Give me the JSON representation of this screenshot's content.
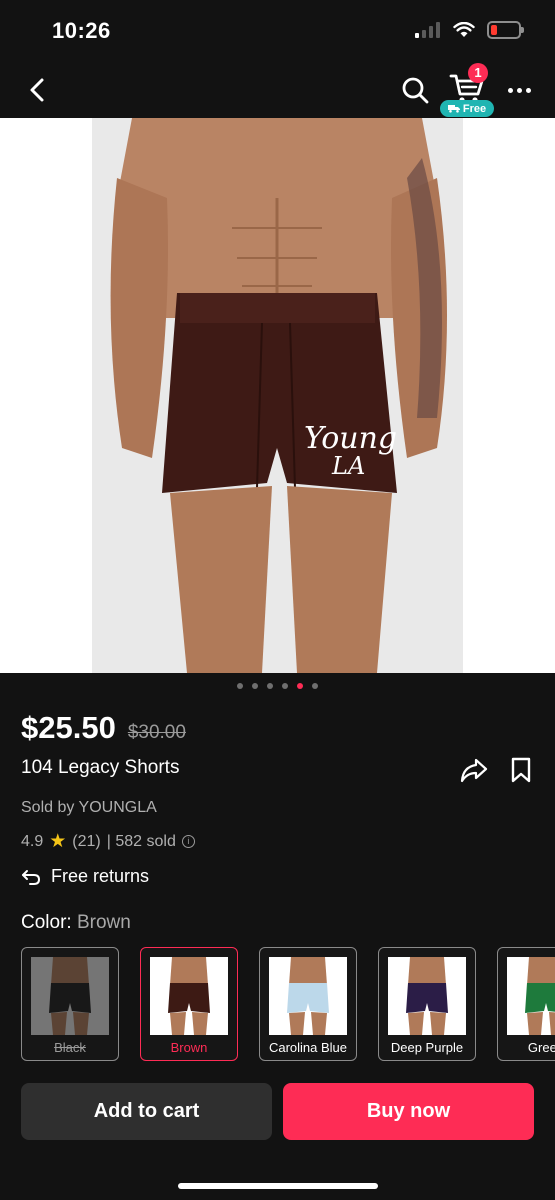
{
  "status": {
    "time": "10:26",
    "battery_color": "#ff3b30"
  },
  "nav": {
    "icons": [
      "chevron-left-icon",
      "search-icon",
      "cart-icon",
      "more-icon"
    ],
    "cart_count": "1",
    "free_label": "Free"
  },
  "gallery": {
    "image_count": 6,
    "active_index": 4,
    "accent": "#fe2c55"
  },
  "product": {
    "price": "$25.50",
    "original_price": "$30.00",
    "title": "104 Legacy Shorts",
    "seller": "Sold by YOUNGLA",
    "rating": "4.9",
    "reviews": "(21)",
    "sold": "| 582 sold",
    "returns": "Free returns"
  },
  "color": {
    "label": "Color:",
    "selected": "Brown",
    "variants": [
      {
        "label": "Black",
        "swatch": "#1c1c1c",
        "state": "unavailable"
      },
      {
        "label": "Brown",
        "swatch": "#3d1a14",
        "state": "selected"
      },
      {
        "label": "Carolina Blue",
        "swatch": "#bcd8ea",
        "state": "available"
      },
      {
        "label": "Deep Purple",
        "swatch": "#2b1d47",
        "state": "available"
      },
      {
        "label": "Green",
        "swatch": "#1e7a3c",
        "state": "available"
      }
    ]
  },
  "actions": {
    "add_to_cart": "Add to cart",
    "buy_now": "Buy now"
  }
}
